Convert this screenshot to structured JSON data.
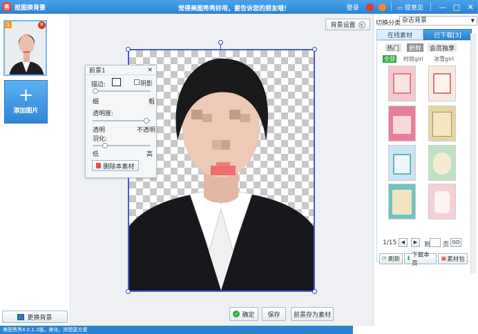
{
  "titlebar": {
    "app_title": "抠图换背景",
    "app_icon_text": "秀",
    "slogan": "觉得美图秀秀好用，要告诉您的朋友哦！",
    "login": "登录",
    "feedback": "提意见",
    "minimize": "—",
    "maximize": "□",
    "close": "✕"
  },
  "left": {
    "thumb_number": "1",
    "add_picture": "添加图片",
    "change_background": "更换背景"
  },
  "canvas": {
    "background_settings": "背景设置",
    "confirm": "确定",
    "save": "保存",
    "save_as_material": "前景存为素材"
  },
  "fg_panel": {
    "title": "前景1",
    "close": "✕",
    "stroke_label": "描边:",
    "shadow_label": "阴影",
    "thin": "细",
    "thick": "粗",
    "opacity_label": "透明度:",
    "transparent": "透明",
    "opaque": "不透明",
    "feather_label": "羽化:",
    "low": "低",
    "high": "高",
    "delete_material": "删除本素材"
  },
  "right": {
    "switch_label": "切换分类",
    "switch_value": "杂志背景",
    "tab_online": "在线素材",
    "tab_downloaded": "已下载[3]",
    "subtabs": [
      "热门",
      "新鲜",
      "会员独享"
    ],
    "categories": [
      "全部",
      "时尚girl",
      "冰雪girl"
    ],
    "page_info": "1/15",
    "prev": "◀",
    "next": "▶",
    "goto_label": "到",
    "page_suffix": "页",
    "go": "GO",
    "refresh": "刷新",
    "download_page": "下载本页",
    "material_pack": "素材包"
  },
  "statusbar": {
    "text": "美图秀秀4.0.1.2版，美化、拼图更方便"
  },
  "colors": {
    "titlebar": "#2b83d3",
    "accent": "#4a58d8",
    "add_button": "#3a95e4"
  }
}
